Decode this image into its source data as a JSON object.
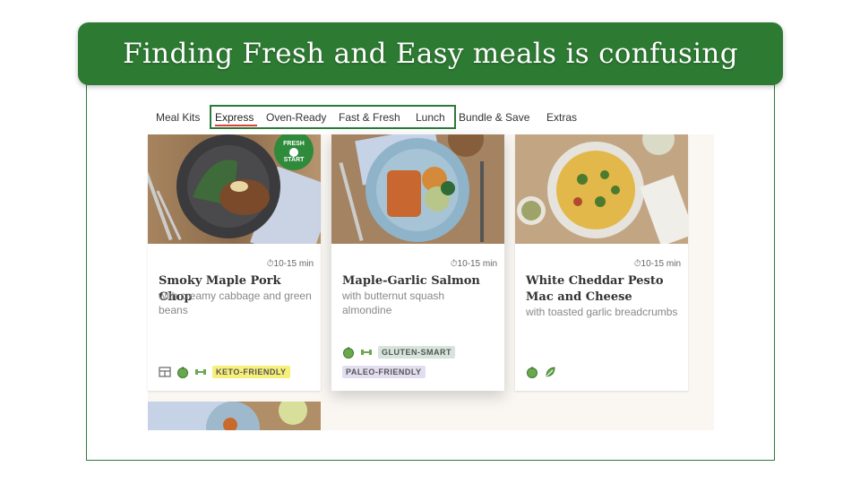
{
  "banner": {
    "title": "Finding Fresh and Easy meals is confusing"
  },
  "nav": {
    "items": [
      {
        "label": "Meal Kits"
      },
      {
        "label": "Express"
      },
      {
        "label": "Oven-Ready"
      },
      {
        "label": "Fast & Fresh"
      },
      {
        "label": "Lunch"
      },
      {
        "label": "Bundle & Save"
      },
      {
        "label": "Extras"
      }
    ],
    "active": "Express"
  },
  "badge": {
    "line1": "FRESH",
    "line2": "START"
  },
  "cards": [
    {
      "time": "10-15 min",
      "title": "Smoky Maple Pork Chop",
      "description": "with creamy cabbage and green beans",
      "icons": [
        "calendar-icon",
        "apple-icon",
        "dumbbell-icon"
      ],
      "tags": [
        "KETO-FRIENDLY"
      ]
    },
    {
      "time": "10-15 min",
      "title": "Maple-Garlic Salmon",
      "description": "with butternut squash almondine",
      "icons": [
        "apple-icon",
        "dumbbell-icon"
      ],
      "tags": [
        "GLUTEN-SMART",
        "PALEO-FRIENDLY"
      ]
    },
    {
      "time": "10-15 min",
      "title": "White Cheddar Pesto Mac and Cheese",
      "description": "with toasted garlic breadcrumbs",
      "icons": [
        "apple-icon",
        "leaf-icon"
      ],
      "tags": []
    }
  ],
  "colors": {
    "accent": "#2d7a32",
    "underline": "#d9423a",
    "keto": "#f6ef7a",
    "gluten": "#d6e4dc",
    "paleo": "#e2ddef"
  }
}
